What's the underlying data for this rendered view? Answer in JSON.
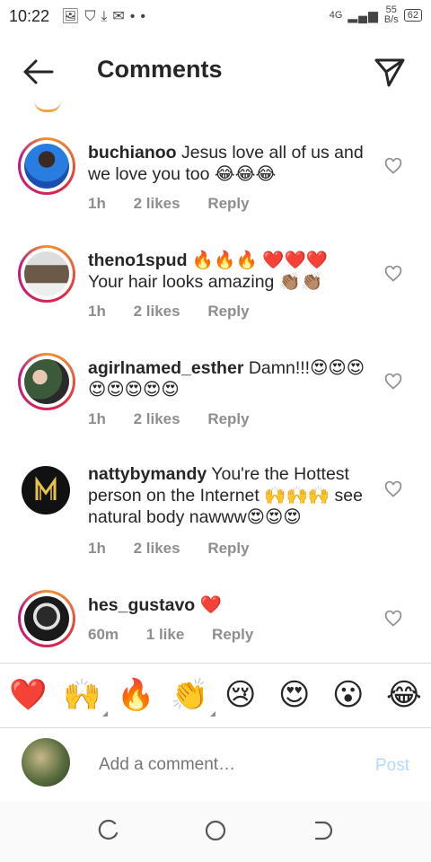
{
  "status_bar": {
    "time": "10:22",
    "network": "4G",
    "speed_top": "55",
    "speed_bottom": "B/s",
    "battery": "62"
  },
  "header": {
    "title": "Comments"
  },
  "comments": [
    {
      "user": "buchianoo",
      "text": " Jesus love all of us and we love you too 😂😂😂",
      "time": "1h",
      "likes": "2 likes",
      "reply": "Reply"
    },
    {
      "user": "theno1spud",
      "text": " 🔥🔥🔥 ❤️❤️❤️ Your hair looks amazing 👏🏽👏🏽",
      "time": "1h",
      "likes": "2 likes",
      "reply": "Reply"
    },
    {
      "user": "agirlnamed_esther",
      "text": " Damn!!!😍😍😍😍😍😍😍😍",
      "time": "1h",
      "likes": "2 likes",
      "reply": "Reply"
    },
    {
      "user": "nattybymandy",
      "text": " You're the Hottest person on the Internet 🙌🙌🙌 see natural body nawww😍😍😍",
      "time": "1h",
      "likes": "2 likes",
      "reply": "Reply"
    },
    {
      "user": "hes_gustavo",
      "text": " ❤️",
      "time": "60m",
      "likes": "1 like",
      "reply": "Reply"
    }
  ],
  "reactions": [
    "❤️",
    "🙌",
    "🔥",
    "👏",
    "😢",
    "😍",
    "😮",
    "😂"
  ],
  "composer": {
    "placeholder": "Add a comment…",
    "post_label": "Post"
  },
  "colors": {
    "accent": "#0095f6",
    "post_disabled": "#b3dbff",
    "heart": "#ed4956"
  }
}
